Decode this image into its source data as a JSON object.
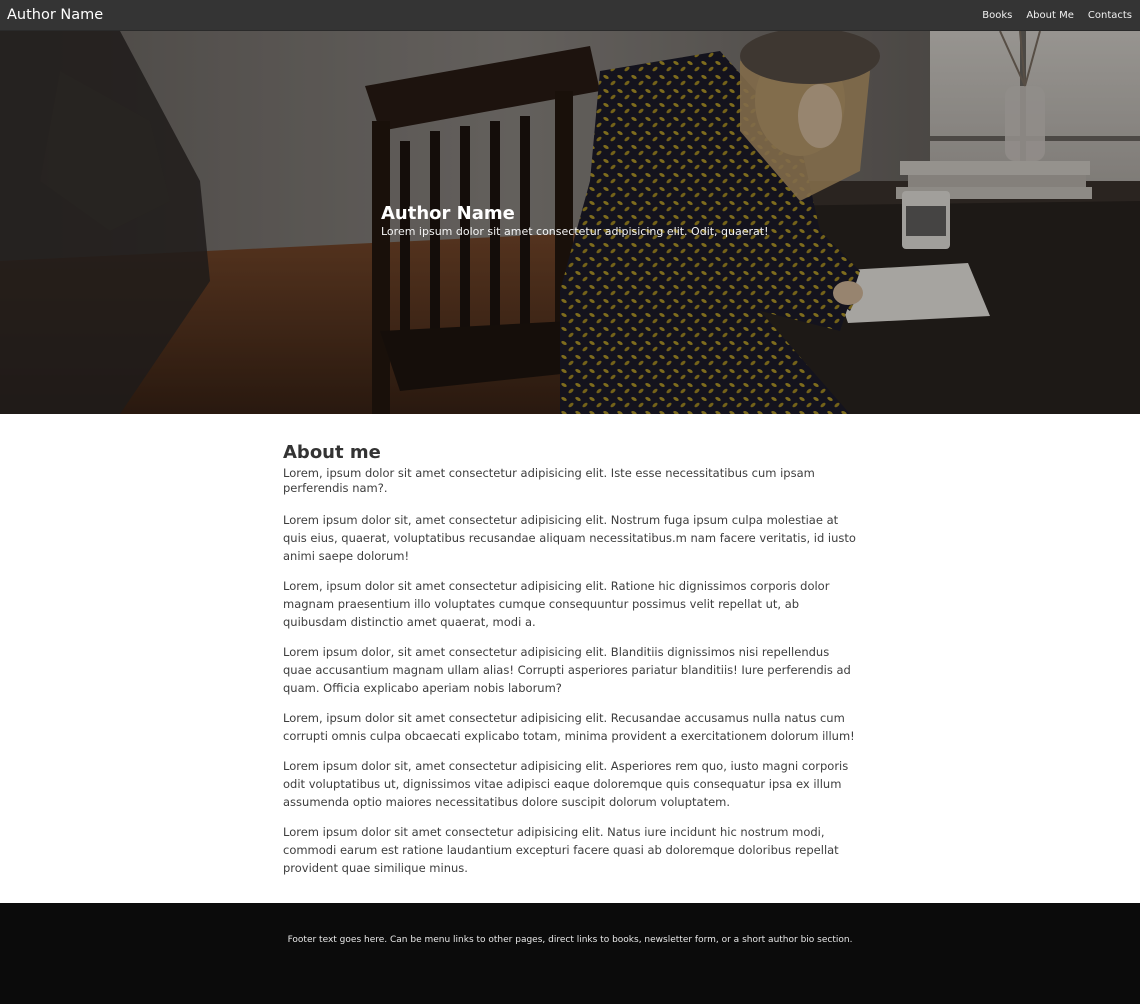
{
  "navbar": {
    "brand": "Author Name",
    "links": [
      "Books",
      "About Me",
      "Contacts"
    ]
  },
  "hero": {
    "title": "Author Name",
    "subtitle": "Lorem ipsum dolor sit amet consectetur adipisicing elit. Odit, quaerat!"
  },
  "about": {
    "title": "About me",
    "lead": "Lorem, ipsum dolor sit amet consectetur adipisicing elit. Iste esse necessitatibus cum ipsam perferendis nam?.",
    "paragraphs": [
      "Lorem ipsum dolor sit, amet consectetur adipisicing elit. Nostrum fuga ipsum culpa molestiae at quis eius, quaerat, voluptatibus recusandae aliquam necessitatibus.m nam facere veritatis, id iusto animi saepe dolorum!",
      "Lorem, ipsum dolor sit amet consectetur adipisicing elit. Ratione hic dignissimos corporis dolor magnam praesentium illo voluptates cumque consequuntur possimus velit repellat ut, ab quibusdam distinctio amet quaerat, modi a.",
      "Lorem ipsum dolor, sit amet consectetur adipisicing elit. Blanditiis dignissimos nisi repellendus quae accusantium magnam ullam alias! Corrupti asperiores pariatur blanditiis! Iure perferendis ad quam. Officia explicabo aperiam nobis laborum?",
      "Lorem, ipsum dolor sit amet consectetur adipisicing elit. Recusandae accusamus nulla natus cum corrupti omnis culpa obcaecati explicabo totam, minima provident a exercitationem dolorum illum!",
      "Lorem ipsum dolor sit, amet consectetur adipisicing elit. Asperiores rem quo, iusto magni corporis odit voluptatibus ut, dignissimos vitae adipisci eaque doloremque quis consequatur ipsa ex illum assumenda optio maiores necessitatibus dolore suscipit dolorum voluptatem.",
      "Lorem ipsum dolor sit amet consectetur adipisicing elit. Natus iure incidunt hic nostrum modi, commodi earum est ratione laudantium excepturi facere quasi ab doloremque doloribus repellat provident quae similique minus."
    ]
  },
  "footer": {
    "text": "Footer text goes here. Can be menu links to other pages, direct links to books, newsletter form, or a short author bio section."
  },
  "colors": {
    "navbar_bg": "#343434",
    "footer_bg": "#0b0b0b",
    "text": "#3d3d3d"
  }
}
